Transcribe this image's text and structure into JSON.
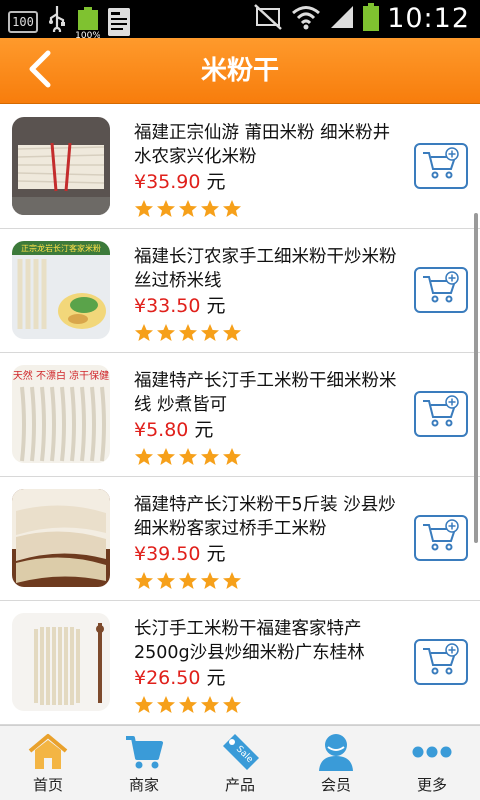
{
  "status_bar": {
    "battery_text": "100",
    "battery_percent_label": "100%",
    "time": "10:12"
  },
  "header": {
    "title": "米粉干",
    "accent_color": "#f98a1b"
  },
  "products": [
    {
      "title": "福建正宗仙游 莆田米粉 细米粉井水农家兴化米粉",
      "price": "¥35.90",
      "unit": "元",
      "rating": 5
    },
    {
      "title": "福建长汀农家手工细米粉干炒米粉丝过桥米线",
      "price": "¥33.50",
      "unit": "元",
      "rating": 5
    },
    {
      "title": "福建特产长汀手工米粉干细米粉米线 炒煮皆可",
      "price": "¥5.80",
      "unit": "元",
      "rating": 5
    },
    {
      "title": "福建特产长汀米粉干5斤装 沙县炒细米粉客家过桥手工米粉",
      "price": "¥39.50",
      "unit": "元",
      "rating": 5
    },
    {
      "title": "长汀手工米粉干福建客家特产2500g沙县炒细米粉广东桂林",
      "price": "¥26.50",
      "unit": "元",
      "rating": 5
    }
  ],
  "thumb_banners": {
    "item2": "正宗龙岩长汀客家米粉",
    "item3": "天然 不漂白 凉干保健"
  },
  "bottom_nav": [
    {
      "label": "首页",
      "icon": "home-icon"
    },
    {
      "label": "商家",
      "icon": "cart-icon"
    },
    {
      "label": "产品",
      "icon": "sale-tag-icon"
    },
    {
      "label": "会员",
      "icon": "member-icon"
    },
    {
      "label": "更多",
      "icon": "more-icon"
    }
  ],
  "colors": {
    "price": "#e0201b",
    "star": "#f6a01a",
    "cart_border": "#3a7cbd",
    "nav_icon": "#3a9bd8"
  }
}
